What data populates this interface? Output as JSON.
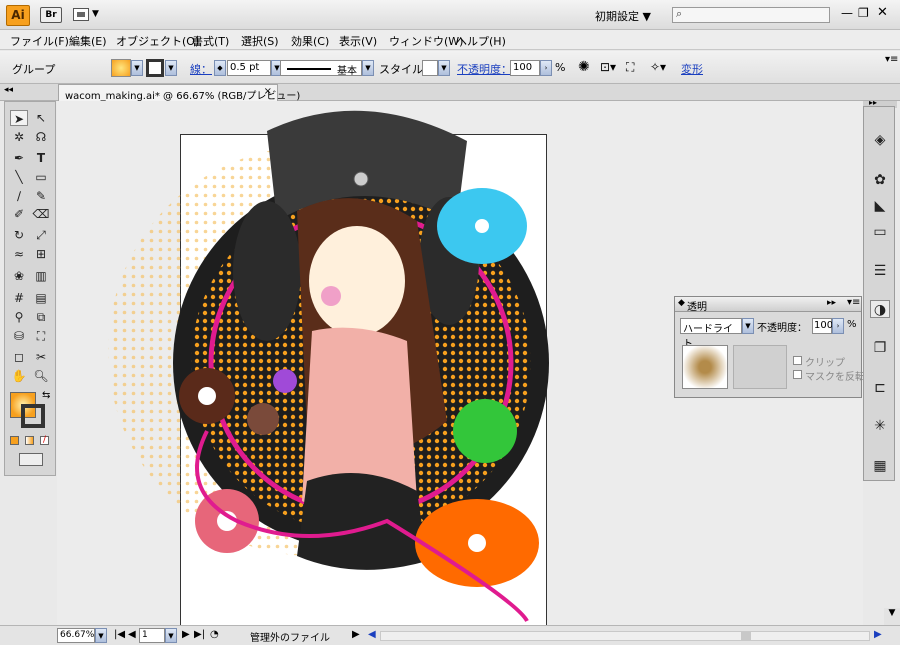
{
  "app": {
    "logo": "Ai",
    "bridge": "Br",
    "workspace": "初期設定 ▼"
  },
  "menu": [
    "ファイル(F)",
    "編集(E)",
    "オブジェクト(O)",
    "書式(T)",
    "選択(S)",
    "効果(C)",
    "表示(V)",
    "ウィンドウ(W)",
    "ヘルプ(H)"
  ],
  "control": {
    "selection": "グループ",
    "stroke_label": "線：",
    "stroke_value": "0.5 pt",
    "brush": "基本",
    "style_label": "スタイル：",
    "opacity_label": "不透明度：",
    "opacity_value": "100",
    "opacity_unit": "%",
    "transform_link": "変形"
  },
  "document": {
    "tab": "wacom_making.ai* @ 66.67% (RGB/プレビュー)",
    "close": "×"
  },
  "transparency_panel": {
    "title": "透明",
    "blend_mode": "ハードライト",
    "opacity_label": "不透明度：",
    "opacity_value": "100",
    "opacity_unit": "%",
    "clip": "クリップ",
    "invert_mask": "マスクを反転"
  },
  "status": {
    "zoom": "66.67%",
    "page": "1",
    "info": "管理外のファイル"
  },
  "icons": [
    "selection-tool",
    "direct-selection-tool",
    "magic-wand-tool",
    "lasso-tool",
    "pen-tool",
    "type-tool",
    "line-tool",
    "rectangle-tool",
    "paintbrush-tool",
    "pencil-tool",
    "blob-brush-tool",
    "eraser-tool",
    "rotate-tool",
    "scale-tool",
    "warp-tool",
    "free-transform-tool",
    "symbol-sprayer-tool",
    "column-graph-tool",
    "mesh-tool",
    "gradient-tool",
    "eyedropper-tool",
    "blend-tool",
    "live-paint-tool",
    "live-paint-selection-tool",
    "artboard-tool",
    "slice-tool",
    "hand-tool",
    "zoom-tool"
  ],
  "colors": {
    "accent": "#f7a01e",
    "link": "#1a3fbf",
    "panel": "#d6d6d6"
  }
}
